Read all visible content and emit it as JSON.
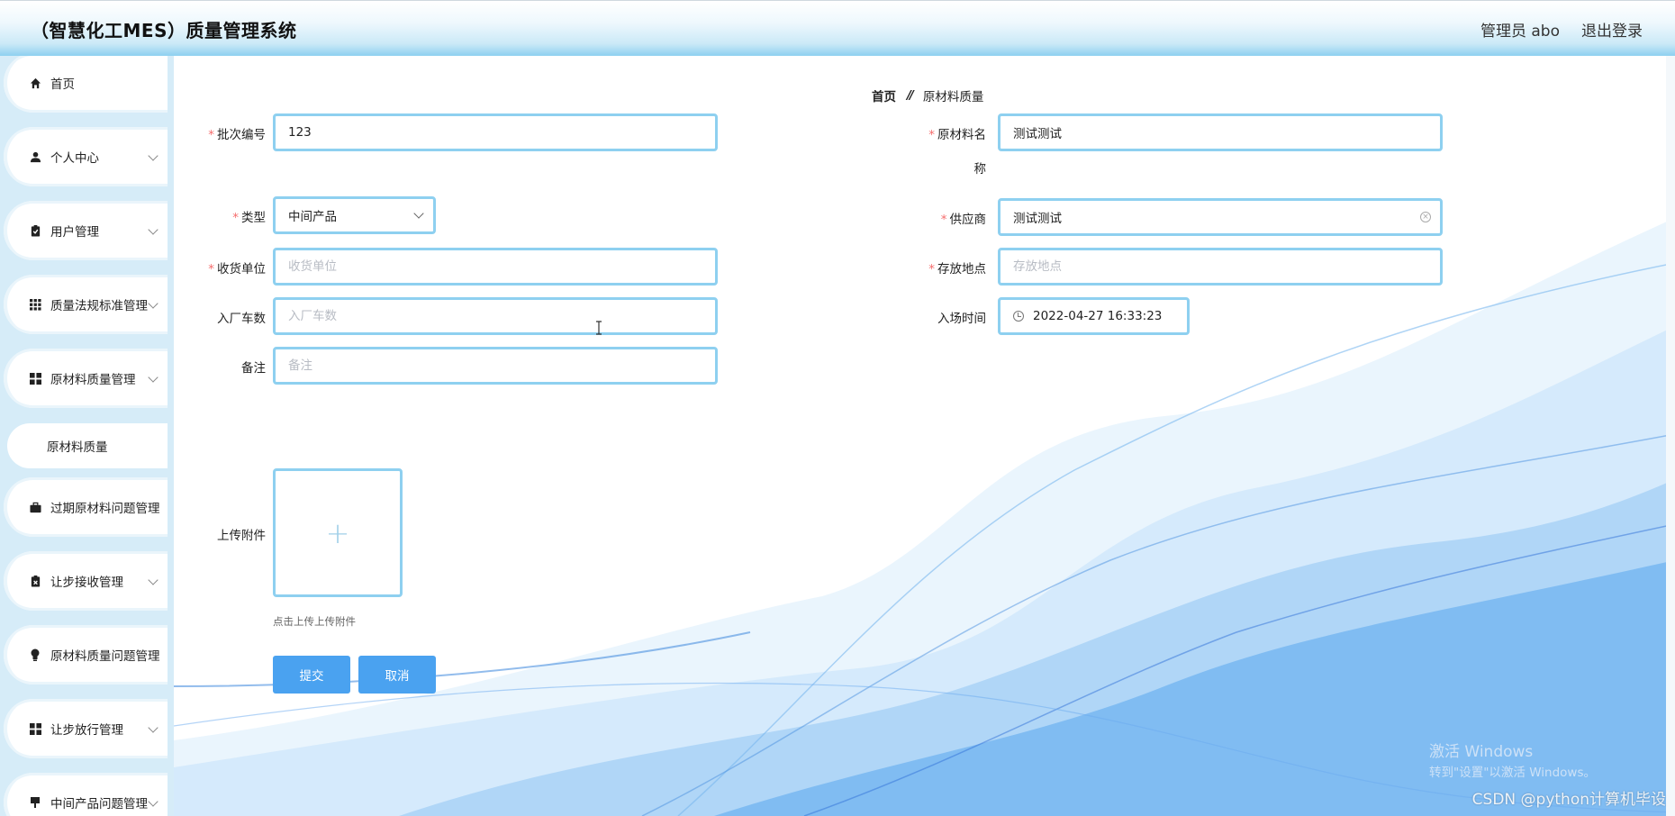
{
  "header": {
    "title": "（智慧化工MES）质量管理系统",
    "user": "管理员 abo",
    "logout": "退出登录"
  },
  "sidebar": {
    "items": [
      {
        "label": "首页",
        "icon": "home-icon"
      },
      {
        "label": "个人中心",
        "icon": "person-icon"
      },
      {
        "label": "用户管理",
        "icon": "clipboard-icon"
      },
      {
        "label": "质量法规标准管理",
        "icon": "grid-icon"
      },
      {
        "label": "原材料质量管理",
        "icon": "grid4-icon"
      },
      {
        "label": "过期原材料问题管理",
        "icon": "briefcase-icon"
      },
      {
        "label": "让步接收管理",
        "icon": "clipboard-x-icon"
      },
      {
        "label": "原材料质量问题管理",
        "icon": "bulb-icon"
      },
      {
        "label": "让步放行管理",
        "icon": "grid4-icon"
      },
      {
        "label": "中间产品问题管理",
        "icon": "mug-icon"
      }
    ],
    "active_sub": "原材料质量"
  },
  "breadcrumb": {
    "home": "首页",
    "sep": "//",
    "current": "原材料质量"
  },
  "form": {
    "batch_no": {
      "label": "批次编号",
      "value": "123"
    },
    "material_name": {
      "label_1": "原材料名",
      "label_2": "称",
      "value": "测试测试"
    },
    "type": {
      "label": "类型",
      "value": "中间产品"
    },
    "supplier": {
      "label": "供应商",
      "value": "测试测试"
    },
    "receiver": {
      "label": "收货单位",
      "placeholder": "收货单位"
    },
    "storage": {
      "label": "存放地点",
      "placeholder": "存放地点"
    },
    "trucks": {
      "label": "入厂车数",
      "placeholder": "入厂车数"
    },
    "entry_time": {
      "label": "入场时间",
      "value": "2022-04-27 16:33:23"
    },
    "remark": {
      "label": "备注",
      "placeholder": "备注"
    },
    "attachment": {
      "label": "上传附件",
      "tip": "点击上传上传附件"
    },
    "submit": "提交",
    "cancel": "取消"
  },
  "overlay": {
    "win_title": "激活 Windows",
    "win_sub": "转到\"设置\"以激活 Windows。",
    "watermark": "CSDN @python计算机毕设"
  }
}
